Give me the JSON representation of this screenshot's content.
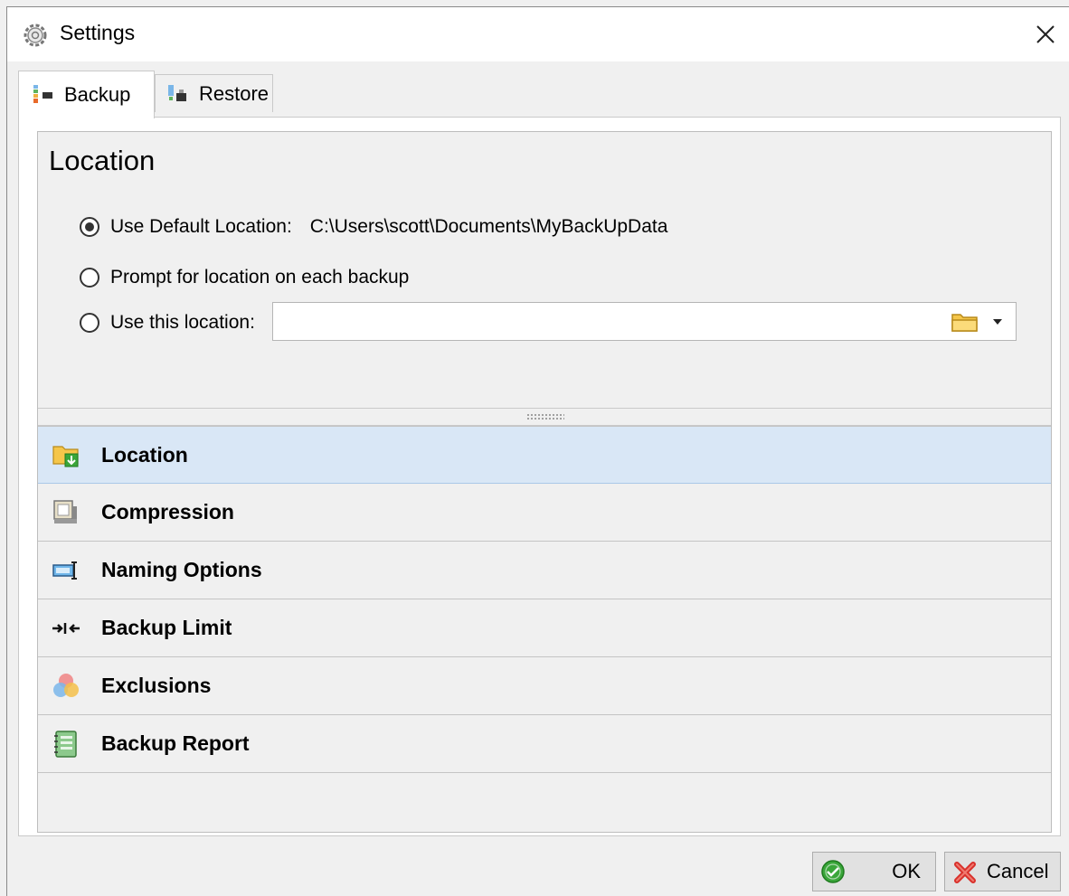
{
  "window": {
    "title": "Settings"
  },
  "tabs": [
    {
      "label": "Backup",
      "active": true,
      "icon": "backup-icon"
    },
    {
      "label": "Restore",
      "active": false,
      "icon": "restore-icon"
    }
  ],
  "location": {
    "title": "Location",
    "options": [
      {
        "label": "Use Default Location:",
        "path": "C:\\Users\\scott\\Documents\\MyBackUpData",
        "checked": true
      },
      {
        "label": "Prompt for location on each backup",
        "checked": false
      },
      {
        "label": "Use this location:",
        "checked": false
      }
    ],
    "custom_path": ""
  },
  "nav": [
    {
      "label": "Location",
      "icon": "folder-download-icon",
      "selected": true
    },
    {
      "label": "Compression",
      "icon": "compression-icon",
      "selected": false
    },
    {
      "label": "Naming Options",
      "icon": "text-field-icon",
      "selected": false
    },
    {
      "label": "Backup Limit",
      "icon": "limit-arrows-icon",
      "selected": false
    },
    {
      "label": "Exclusions",
      "icon": "color-circles-icon",
      "selected": false
    },
    {
      "label": "Backup Report",
      "icon": "notebook-icon",
      "selected": false
    }
  ],
  "buttons": {
    "ok": "OK",
    "cancel": "Cancel"
  },
  "colors": {
    "selected_row": "#d9e7f6",
    "ok_green": "#3aa63a",
    "cancel_red": "#d9302b"
  }
}
